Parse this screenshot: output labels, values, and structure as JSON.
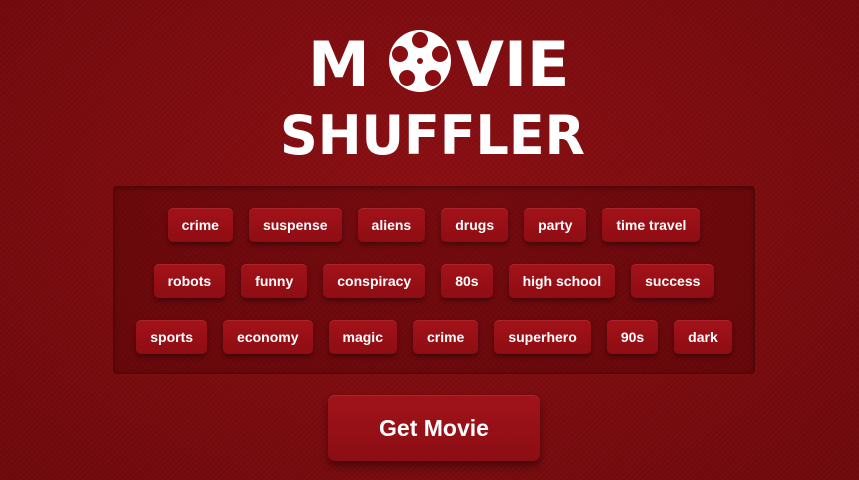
{
  "logo": {
    "line1_prefix": "M",
    "line1_suffix": "VIE",
    "line2": "SHUFFLER",
    "reel_icon": "film-reel-icon"
  },
  "tags": {
    "row1": [
      "crime",
      "suspense",
      "aliens",
      "drugs",
      "party",
      "time travel"
    ],
    "row2": [
      "robots",
      "funny",
      "conspiracy",
      "80s",
      "high school",
      "success"
    ],
    "row3": [
      "sports",
      "economy",
      "magic",
      "crime",
      "superhero",
      "90s",
      "dark"
    ]
  },
  "actions": {
    "get_movie_label": "Get Movie"
  },
  "colors": {
    "background": "#7e0b0e",
    "tag_background": "#9a1017",
    "text": "#ffffff"
  }
}
